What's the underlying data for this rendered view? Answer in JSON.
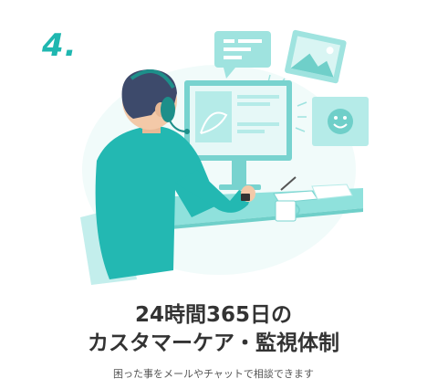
{
  "step": {
    "number": "4."
  },
  "headline": {
    "line1": "24時間365日の",
    "line2": "カスタマーケア・監視体制"
  },
  "subtext": "困った事をメールやチャットで相談できます",
  "colors": {
    "accent": "#1fb7b0",
    "screen_frame": "#78d3cf",
    "shirt": "#23b8b2",
    "desk": "#8fe1dc",
    "text": "#333333",
    "subtext": "#555555"
  },
  "icons": [
    "chat-bubble-icon",
    "image-icon",
    "smiley-icon",
    "headset-icon",
    "monitor-icon",
    "coffee-cup-icon",
    "smartwatch-icon"
  ]
}
